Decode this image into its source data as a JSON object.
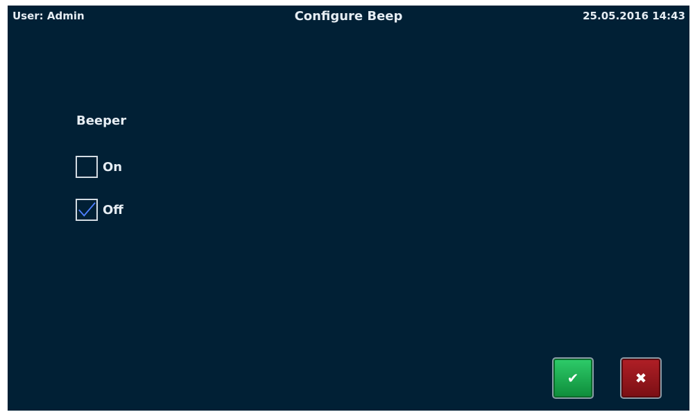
{
  "header": {
    "user": "User: Admin",
    "title": "Configure Beep",
    "datetime": "25.05.2016 14:43"
  },
  "beeper": {
    "label": "Beeper",
    "options": [
      {
        "label": "On",
        "checked": false
      },
      {
        "label": "Off",
        "checked": true
      }
    ]
  },
  "actions": {
    "confirm_icon": "✔",
    "cancel_icon": "✖"
  },
  "colors": {
    "background": "#012035",
    "check_mark": "#4f7fff",
    "confirm": "#1aa14b",
    "cancel": "#9c161c"
  }
}
